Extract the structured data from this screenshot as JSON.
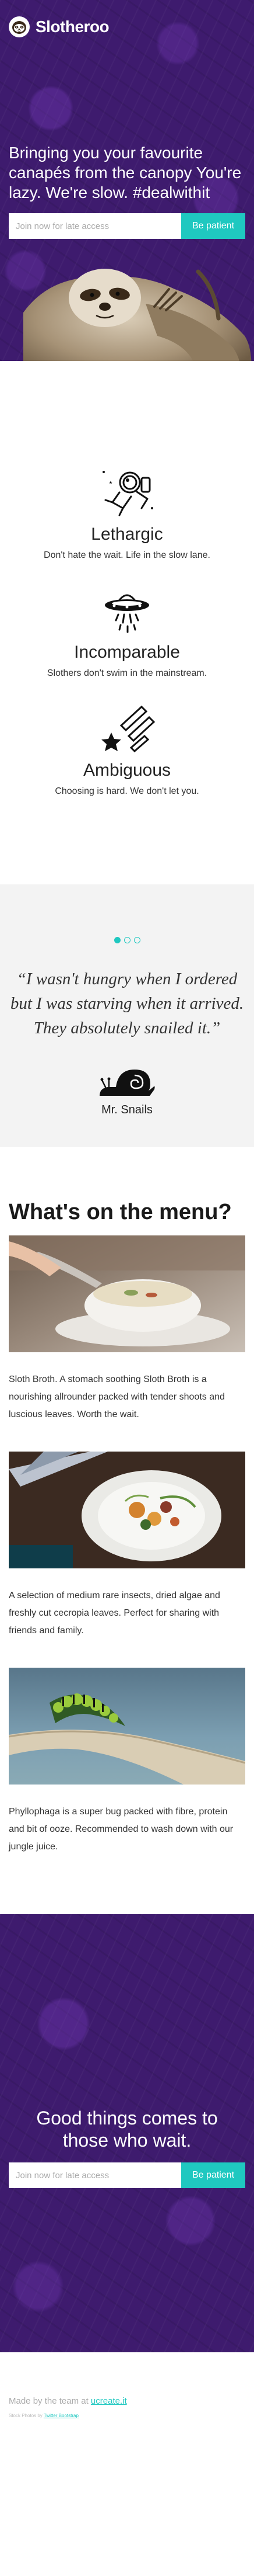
{
  "brand": {
    "name": "Slotheroo",
    "logo_icon": "sloth-face-icon"
  },
  "hero": {
    "headline": "Bringing you your favourite canapés from the canopy You're lazy. We're slow. #dealwithit",
    "input_placeholder": "Join now for late access",
    "button_label": "Be patient"
  },
  "features": [
    {
      "icon": "lazy-astronaut-icon",
      "title": "Lethargic",
      "description": "Don't hate the wait. Life in the slow lane."
    },
    {
      "icon": "ufo-icon",
      "title": "Incomparable",
      "description": "Slothers don't swim in the mainstream."
    },
    {
      "icon": "shooting-stars-icon",
      "title": "Ambiguous",
      "description": "Choosing is hard. We don't let you."
    }
  ],
  "testimonial": {
    "quote": "“I wasn't hungry when I ordered but I was starving when it arrived. They absolutely snailed it.”",
    "author": "Mr. Snails",
    "slides": 3,
    "active_slide": 1
  },
  "menu": {
    "heading": "What's on the menu?",
    "items": [
      {
        "photo": "soup-bowl-photo",
        "description": "Sloth Broth. A stomach soothing Sloth Broth is a nourishing allrounder packed with tender shoots and luscious leaves. Worth the wait."
      },
      {
        "photo": "salad-plate-photo",
        "description": "A selection of medium rare insects, dried algae and freshly cut cecropia leaves. Perfect for sharing with friends and family."
      },
      {
        "photo": "caterpillar-on-branch-photo",
        "description": "Phyllophaga is a super bug packed with fibre, protein and bit of ooze. Recommended to wash down with our jungle juice."
      }
    ]
  },
  "cta": {
    "headline": "Good things comes to those who wait.",
    "input_placeholder": "Join now for late access",
    "button_label": "Be patient"
  },
  "footer": {
    "made_by_prefix": "Made by the team at",
    "made_by_link": "ucreate.it",
    "small_prefix": "Stock Photos by",
    "small_link": "Twitter Bootstrap"
  },
  "colors": {
    "purple": "#3e1b6e",
    "accent": "#1fc8c0",
    "testimonial_bg": "#f3f3f3"
  }
}
